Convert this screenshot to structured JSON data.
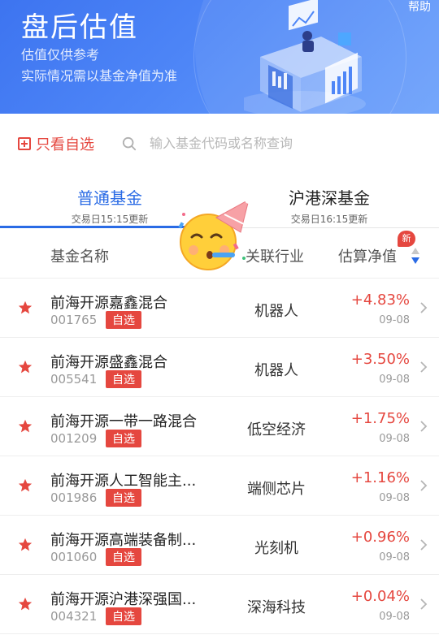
{
  "header": {
    "title": "盘后估值",
    "subtitle_1": "估值仅供参考",
    "subtitle_2": "实际情况需以基金净值为准",
    "help": "帮助"
  },
  "filter": {
    "only_favorites_label": "只看自选",
    "search_placeholder": "输入基金代码或名称查询"
  },
  "tabs": [
    {
      "label": "普通基金",
      "update_time": "交易日15:15更新",
      "active": true
    },
    {
      "label": "沪港深基金",
      "update_time": "交易日16:15更新",
      "active": false
    }
  ],
  "columns": {
    "name": "基金名称",
    "industry": "关联行业",
    "estimate": "估算净值",
    "new_badge": "新"
  },
  "funds": [
    {
      "name": "前海开源嘉鑫混合",
      "code": "001765",
      "tag": "自选",
      "industry": "机器人",
      "change": "+4.83%",
      "date": "09-08"
    },
    {
      "name": "前海开源盛鑫混合",
      "code": "005541",
      "tag": "自选",
      "industry": "机器人",
      "change": "+3.50%",
      "date": "09-08"
    },
    {
      "name": "前海开源一带一路混合",
      "code": "001209",
      "tag": "自选",
      "industry": "低空经济",
      "change": "+1.75%",
      "date": "09-08"
    },
    {
      "name": "前海开源人工智能主...",
      "code": "001986",
      "tag": "自选",
      "industry": "端侧芯片",
      "change": "+1.16%",
      "date": "09-08"
    },
    {
      "name": "前海开源高端装备制...",
      "code": "001060",
      "tag": "自选",
      "industry": "光刻机",
      "change": "+0.96%",
      "date": "09-08"
    },
    {
      "name": "前海开源沪港深强国...",
      "code": "004321",
      "tag": "自选",
      "industry": "深海科技",
      "change": "+0.04%",
      "date": "09-08"
    }
  ],
  "colors": {
    "primary_blue": "#2a6be5",
    "rise_red": "#e5473f",
    "header_gradient_start": "#3d74f0",
    "header_gradient_end": "#6aa0fb"
  },
  "icons": [
    "star-icon",
    "search-icon",
    "chevron-right-icon",
    "sort-icon",
    "party-emoji-icon",
    "add-favorite-icon"
  ]
}
